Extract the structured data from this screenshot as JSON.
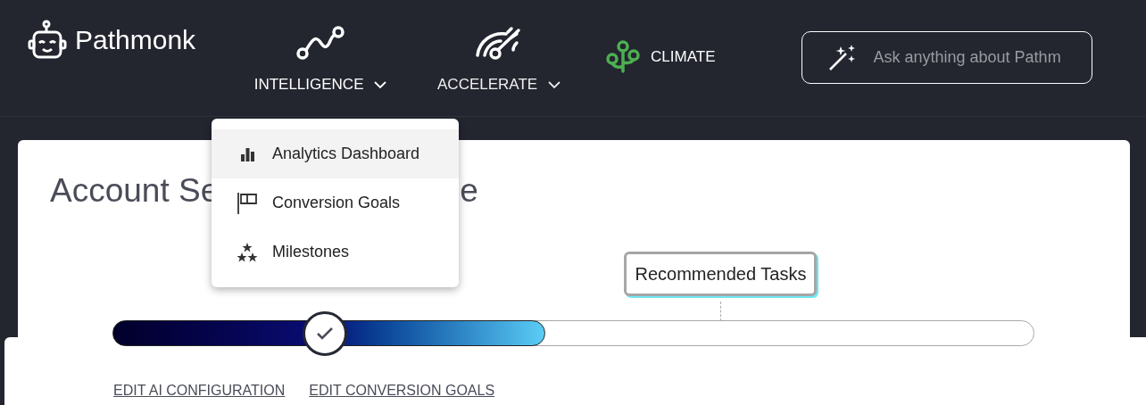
{
  "brand": {
    "name": "Pathmonk"
  },
  "nav": [
    {
      "kind": "dropdown",
      "label": "INTELLIGENCE",
      "expanded": true
    },
    {
      "kind": "dropdown",
      "label": "ACCELERATE",
      "expanded": false
    },
    {
      "kind": "plain",
      "label": "CLIMATE"
    }
  ],
  "search": {
    "placeholder": "Ask anything about Pathm"
  },
  "menu": [
    {
      "label": "Analytics Dashboard",
      "selected": true
    },
    {
      "label": "Conversion Goals",
      "selected": false
    },
    {
      "label": "Milestones",
      "selected": false
    }
  ],
  "title_parts": [
    "Account Se",
    "e"
  ],
  "progress": {
    "level": 0.47,
    "marker_label": "Recommended Tasks"
  },
  "links": [
    "EDIT AI CONFIGURATION",
    "EDIT CONVERSION GOALS"
  ]
}
